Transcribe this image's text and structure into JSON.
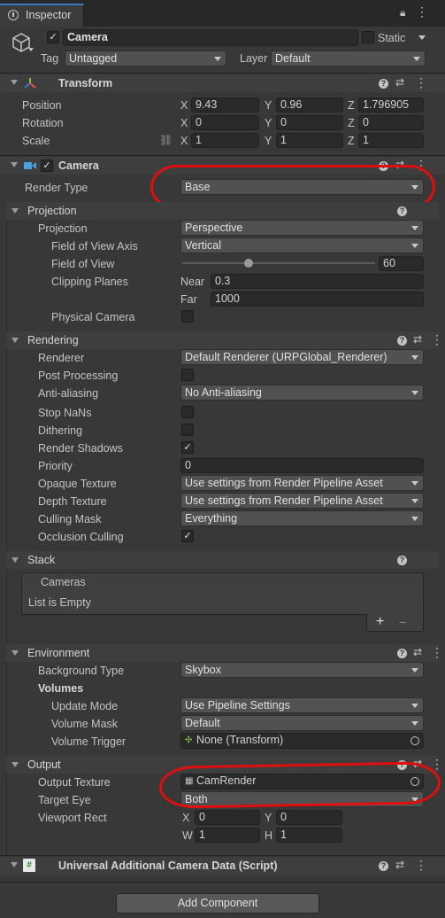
{
  "window": {
    "tab_label": "Inspector"
  },
  "object": {
    "name": "Camera",
    "static_label": "Static",
    "tag_label": "Tag",
    "tag_value": "Untagged",
    "layer_label": "Layer",
    "layer_value": "Default"
  },
  "transform": {
    "title": "Transform",
    "position_label": "Position",
    "rotation_label": "Rotation",
    "scale_label": "Scale",
    "position": {
      "x": "9.43",
      "y": "0.96",
      "z": "1.796905"
    },
    "rotation": {
      "x": "0",
      "y": "0",
      "z": "0"
    },
    "scale": {
      "x": "1",
      "y": "1",
      "z": "1"
    }
  },
  "axes": {
    "x": "X",
    "y": "Y",
    "z": "Z",
    "w": "W",
    "h": "H"
  },
  "camera": {
    "title": "Camera",
    "render_type_label": "Render Type",
    "render_type": "Base"
  },
  "projection": {
    "title": "Projection",
    "projection_label": "Projection",
    "projection_value": "Perspective",
    "fov_axis_label": "Field of View Axis",
    "fov_axis_value": "Vertical",
    "fov_label": "Field of View",
    "fov_value": "60",
    "fov_slider_fraction": 0.343,
    "clip_label": "Clipping Planes",
    "near_label": "Near",
    "near_value": "0.3",
    "far_label": "Far",
    "far_value": "1000",
    "physical_label": "Physical Camera"
  },
  "rendering": {
    "title": "Rendering",
    "renderer_label": "Renderer",
    "renderer_value": "Default Renderer (URPGlobal_Renderer)",
    "post_label": "Post Processing",
    "aa_label": "Anti-aliasing",
    "aa_value": "No Anti-aliasing",
    "stopnans_label": "Stop NaNs",
    "dither_label": "Dithering",
    "shadows_label": "Render Shadows",
    "priority_label": "Priority",
    "priority_value": "0",
    "opaque_label": "Opaque Texture",
    "opaque_value": "Use settings from Render Pipeline Asset",
    "depth_label": "Depth Texture",
    "depth_value": "Use settings from Render Pipeline Asset",
    "cull_label": "Culling Mask",
    "cull_value": "Everything",
    "occl_label": "Occlusion Culling"
  },
  "stack": {
    "title": "Stack",
    "cameras_label": "Cameras",
    "empty_label": "List is Empty",
    "add": "+",
    "remove": "−"
  },
  "environment": {
    "title": "Environment",
    "bg_label": "Background Type",
    "bg_value": "Skybox",
    "volumes_label": "Volumes",
    "update_label": "Update Mode",
    "update_value": "Use Pipeline Settings",
    "mask_label": "Volume Mask",
    "mask_value": "Default",
    "trigger_label": "Volume Trigger",
    "trigger_value": "None (Transform)"
  },
  "output": {
    "title": "Output",
    "tex_label": "Output Texture",
    "tex_value": "CamRender",
    "eye_label": "Target Eye",
    "eye_value": "Both",
    "vp_label": "Viewport Rect",
    "vp_x": "0",
    "vp_y": "0",
    "vp_w": "1",
    "vp_h": "1"
  },
  "script": {
    "title": "Universal Additional Camera Data (Script)"
  },
  "footer": {
    "add_component": "Add Component"
  },
  "colors": {
    "annotation": "#e10e0e",
    "accent": "#3a79bb"
  }
}
